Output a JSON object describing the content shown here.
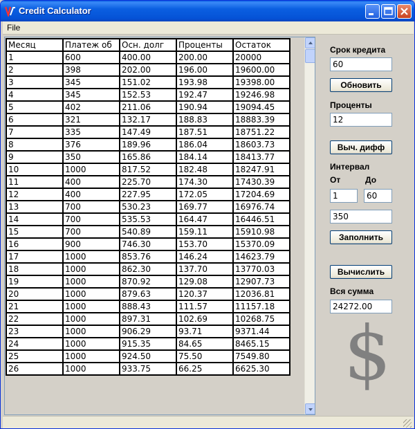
{
  "window": {
    "title": "Credit Calculator"
  },
  "menu": {
    "file": "File"
  },
  "icons": {
    "app": "calculator-app-icon",
    "minimize": "minimize-icon",
    "maximize": "maximize-icon",
    "close": "close-icon"
  },
  "table": {
    "columns": [
      "Месяц",
      "Платеж об",
      "Осн. долг",
      "Проценты",
      "Остаток"
    ],
    "rows": [
      [
        "1",
        "600",
        "400.00",
        "200.00",
        "20000"
      ],
      [
        "2",
        "398",
        "202.00",
        "196.00",
        "19600.00"
      ],
      [
        "3",
        "345",
        "151.02",
        "193.98",
        "19398.00"
      ],
      [
        "4",
        "345",
        "152.53",
        "192.47",
        "19246.98"
      ],
      [
        "5",
        "402",
        "211.06",
        "190.94",
        "19094.45"
      ],
      [
        "6",
        "321",
        "132.17",
        "188.83",
        "18883.39"
      ],
      [
        "7",
        "335",
        "147.49",
        "187.51",
        "18751.22"
      ],
      [
        "8",
        "376",
        "189.96",
        "186.04",
        "18603.73"
      ],
      [
        "9",
        "350",
        "165.86",
        "184.14",
        "18413.77"
      ],
      [
        "10",
        "1000",
        "817.52",
        "182.48",
        "18247.91"
      ],
      [
        "11",
        "400",
        "225.70",
        "174.30",
        "17430.39"
      ],
      [
        "12",
        "400",
        "227.95",
        "172.05",
        "17204.69"
      ],
      [
        "13",
        "700",
        "530.23",
        "169.77",
        "16976.74"
      ],
      [
        "14",
        "700",
        "535.53",
        "164.47",
        "16446.51"
      ],
      [
        "15",
        "700",
        "540.89",
        "159.11",
        "15910.98"
      ],
      [
        "16",
        "900",
        "746.30",
        "153.70",
        "15370.09"
      ],
      [
        "17",
        "1000",
        "853.76",
        "146.24",
        "14623.79"
      ],
      [
        "18",
        "1000",
        "862.30",
        "137.70",
        "13770.03"
      ],
      [
        "19",
        "1000",
        "870.92",
        "129.08",
        "12907.73"
      ],
      [
        "20",
        "1000",
        "879.63",
        "120.37",
        "12036.81"
      ],
      [
        "21",
        "1000",
        "888.43",
        "111.57",
        "11157.18"
      ],
      [
        "22",
        "1000",
        "897.31",
        "102.69",
        "10268.75"
      ],
      [
        "23",
        "1000",
        "906.29",
        "93.71",
        "9371.44"
      ],
      [
        "24",
        "1000",
        "915.35",
        "84.65",
        "8465.15"
      ],
      [
        "25",
        "1000",
        "924.50",
        "75.50",
        "7549.80"
      ],
      [
        "26",
        "1000",
        "933.75",
        "66.25",
        "6625.30"
      ]
    ]
  },
  "panel": {
    "term_label": "Срок кредита",
    "term_value": "60",
    "refresh_button": "Обновить",
    "rate_label": "Проценты",
    "rate_value": "12",
    "diff_button": "Выч. дифф",
    "interval_label": "Интервал",
    "from_label": "От",
    "to_label": "До",
    "from_value": "1",
    "to_value": "60",
    "fill_value": "350",
    "fill_button": "Заполнить",
    "calc_button": "Вычислить",
    "total_label": "Вся сумма",
    "total_value": "24272.00",
    "logo": "$"
  }
}
